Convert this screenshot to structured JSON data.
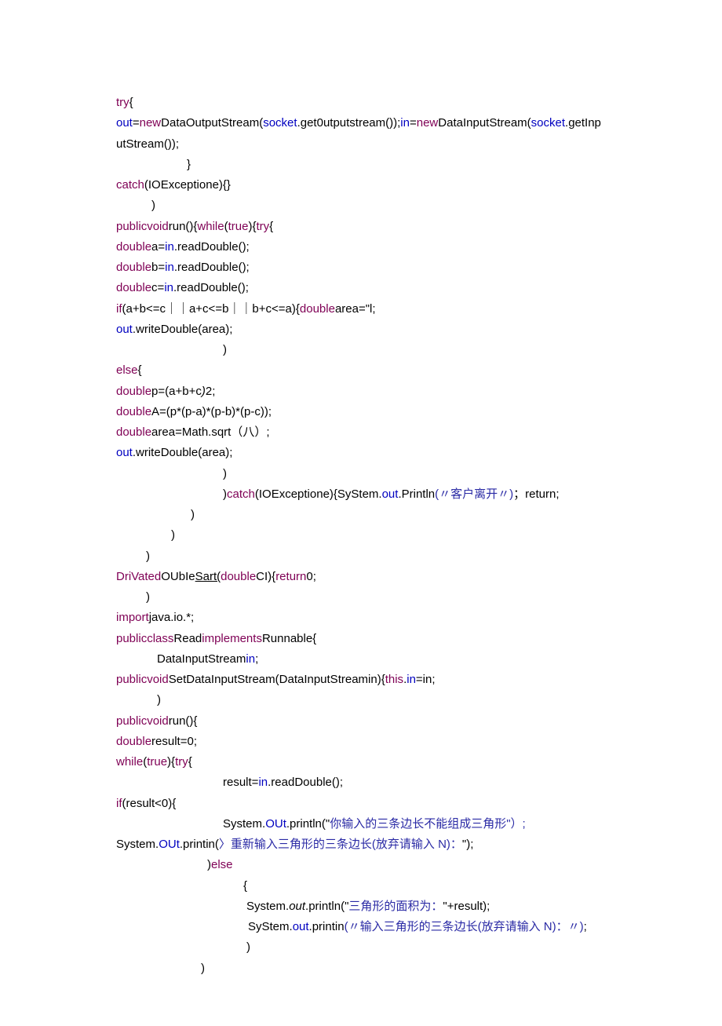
{
  "lines": [
    {
      "indent": 0,
      "spans": [
        {
          "t": "try",
          "c": "kw"
        },
        {
          "t": "{",
          "c": "blk"
        }
      ]
    },
    {
      "indent": 0,
      "spans": [
        {
          "t": "out",
          "c": "id"
        },
        {
          "t": "=",
          "c": "blk"
        },
        {
          "t": "new",
          "c": "kw"
        },
        {
          "t": "DataOutputStream(",
          "c": "blk"
        },
        {
          "t": "socket",
          "c": "id"
        },
        {
          "t": ".get0utputstream());",
          "c": "blk"
        },
        {
          "t": "in",
          "c": "id"
        },
        {
          "t": "=",
          "c": "blk"
        },
        {
          "t": "new",
          "c": "kw"
        },
        {
          "t": "DataInputStream(",
          "c": "blk"
        },
        {
          "t": "socket",
          "c": "id"
        },
        {
          "t": ".getInputStream());",
          "c": "blk"
        }
      ]
    },
    {
      "indent": 90,
      "spans": [
        {
          "t": "}",
          "c": "blk"
        }
      ]
    },
    {
      "indent": 0,
      "spans": [
        {
          "t": "catch",
          "c": "kw"
        },
        {
          "t": "(IOExceptione){}",
          "c": "blk"
        }
      ]
    },
    {
      "indent": 45,
      "spans": [
        {
          "t": ")",
          "c": "blk"
        }
      ]
    },
    {
      "indent": 0,
      "spans": [
        {
          "t": "public",
          "c": "kw"
        },
        {
          "t": "void",
          "c": "kw"
        },
        {
          "t": "run(){",
          "c": "blk"
        },
        {
          "t": "while",
          "c": "kw"
        },
        {
          "t": "(",
          "c": "blk"
        },
        {
          "t": "true",
          "c": "kw"
        },
        {
          "t": "){",
          "c": "blk"
        },
        {
          "t": "try",
          "c": "kw"
        },
        {
          "t": "{",
          "c": "blk"
        }
      ]
    },
    {
      "indent": 0,
      "spans": [
        {
          "t": "double",
          "c": "kw"
        },
        {
          "t": "a=",
          "c": "blk"
        },
        {
          "t": "in",
          "c": "id"
        },
        {
          "t": ".readDouble();",
          "c": "blk"
        }
      ]
    },
    {
      "indent": 0,
      "spans": [
        {
          "t": "double",
          "c": "kw"
        },
        {
          "t": "b=",
          "c": "blk"
        },
        {
          "t": "in",
          "c": "id"
        },
        {
          "t": ".readDouble();",
          "c": "blk"
        }
      ]
    },
    {
      "indent": 0,
      "spans": [
        {
          "t": "double",
          "c": "kw"
        },
        {
          "t": "c=",
          "c": "blk"
        },
        {
          "t": "in",
          "c": "id"
        },
        {
          "t": ".readDouble();",
          "c": "blk"
        }
      ]
    },
    {
      "indent": 0,
      "spans": [
        {
          "t": "if",
          "c": "kw"
        },
        {
          "t": "(a+b<=c｜｜a+c<=b｜｜b+c<=a){",
          "c": "blk"
        },
        {
          "t": "double",
          "c": "kw"
        },
        {
          "t": "area=\"l;",
          "c": "blk"
        }
      ]
    },
    {
      "indent": 0,
      "spans": [
        {
          "t": "out",
          "c": "id"
        },
        {
          "t": ".writeDouble(area);",
          "c": "blk"
        }
      ]
    },
    {
      "indent": 136,
      "spans": [
        {
          "t": ")",
          "c": "blk"
        }
      ]
    },
    {
      "indent": 0,
      "spans": [
        {
          "t": "else",
          "c": "kw"
        },
        {
          "t": "{",
          "c": "blk"
        }
      ]
    },
    {
      "indent": 0,
      "spans": [
        {
          "t": "double",
          "c": "kw"
        },
        {
          "t": "p=(a+b+c",
          "c": "blk"
        },
        {
          "t": ")",
          "c": "it"
        },
        {
          "t": "2;",
          "c": "blk"
        }
      ]
    },
    {
      "indent": 0,
      "spans": [
        {
          "t": "double",
          "c": "kw"
        },
        {
          "t": "A=(p*(p-a)*(p-b)*(p-c));",
          "c": "blk"
        }
      ]
    },
    {
      "indent": 0,
      "spans": [
        {
          "t": "double",
          "c": "kw"
        },
        {
          "t": "area=Math.sqrt（八）;",
          "c": "blk"
        }
      ]
    },
    {
      "indent": 0,
      "spans": [
        {
          "t": "out",
          "c": "id"
        },
        {
          "t": ".writeDouble(area);",
          "c": "blk"
        }
      ]
    },
    {
      "indent": 136,
      "spans": [
        {
          "t": ")",
          "c": "blk"
        }
      ]
    },
    {
      "indent": 136,
      "spans": [
        {
          "t": ")",
          "c": "blk"
        },
        {
          "t": "catch",
          "c": "kw"
        },
        {
          "t": "(IOExceptione){SyStem.",
          "c": "blk"
        },
        {
          "t": "out",
          "c": "id"
        },
        {
          "t": ".Println",
          "c": "blk"
        },
        {
          "t": "(〃客户离开〃)",
          "c": "str"
        },
        {
          "t": "；return;",
          "c": "blk"
        }
      ]
    },
    {
      "indent": 95,
      "spans": [
        {
          "t": ")",
          "c": "blk"
        }
      ]
    },
    {
      "indent": 70,
      "spans": [
        {
          "t": ")",
          "c": "blk"
        }
      ]
    },
    {
      "indent": 38,
      "spans": [
        {
          "t": ")",
          "c": "blk"
        }
      ]
    },
    {
      "indent": 0,
      "spans": [
        {
          "t": "DriVated",
          "c": "kw"
        },
        {
          "t": "OUbIe",
          "c": "blk"
        },
        {
          "t": "Sart(",
          "c": "ul"
        },
        {
          "t": "double",
          "c": "kw"
        },
        {
          "t": "CI){",
          "c": "blk"
        },
        {
          "t": "return",
          "c": "kw"
        },
        {
          "t": "0;",
          "c": "blk"
        }
      ]
    },
    {
      "indent": 38,
      "spans": [
        {
          "t": ")",
          "c": "blk"
        }
      ]
    },
    {
      "indent": 0,
      "spans": [
        {
          "t": "import",
          "c": "kw"
        },
        {
          "t": "java.io.*;",
          "c": "blk"
        }
      ]
    },
    {
      "indent": 0,
      "spans": [
        {
          "t": "public",
          "c": "kw"
        },
        {
          "t": "class",
          "c": "kw"
        },
        {
          "t": "Read",
          "c": "blk"
        },
        {
          "t": "implements",
          "c": "kw"
        },
        {
          "t": "Runnable{",
          "c": "blk"
        }
      ]
    },
    {
      "indent": 52,
      "spans": [
        {
          "t": "DataInputStream",
          "c": "blk"
        },
        {
          "t": "in",
          "c": "id"
        },
        {
          "t": ";",
          "c": "blk"
        }
      ]
    },
    {
      "indent": 0,
      "spans": [
        {
          "t": "public",
          "c": "kw"
        },
        {
          "t": "void",
          "c": "kw"
        },
        {
          "t": "SetDataInputStream(DataInputStreamin){",
          "c": "blk"
        },
        {
          "t": "this",
          "c": "kw"
        },
        {
          "t": ".",
          "c": "blk"
        },
        {
          "t": "in",
          "c": "id"
        },
        {
          "t": "=in;",
          "c": "blk"
        }
      ]
    },
    {
      "indent": 52,
      "spans": [
        {
          "t": ")",
          "c": "blk"
        }
      ]
    },
    {
      "indent": 0,
      "spans": [
        {
          "t": "public",
          "c": "kw"
        },
        {
          "t": "void",
          "c": "kw"
        },
        {
          "t": "run(){",
          "c": "blk"
        }
      ]
    },
    {
      "indent": 0,
      "spans": [
        {
          "t": "double",
          "c": "kw"
        },
        {
          "t": "result=0;",
          "c": "blk"
        }
      ]
    },
    {
      "indent": 0,
      "spans": [
        {
          "t": "while",
          "c": "kw"
        },
        {
          "t": "(",
          "c": "blk"
        },
        {
          "t": "true",
          "c": "kw"
        },
        {
          "t": "){",
          "c": "blk"
        },
        {
          "t": "try",
          "c": "kw"
        },
        {
          "t": "{",
          "c": "blk"
        }
      ]
    },
    {
      "indent": 136,
      "spans": [
        {
          "t": "result=",
          "c": "blk"
        },
        {
          "t": "in",
          "c": "id"
        },
        {
          "t": ".readDouble();",
          "c": "blk"
        }
      ]
    },
    {
      "indent": 0,
      "spans": [
        {
          "t": "if",
          "c": "kw"
        },
        {
          "t": "(result<0){",
          "c": "blk"
        }
      ]
    },
    {
      "indent": 136,
      "spans": [
        {
          "t": "System.",
          "c": "blk"
        },
        {
          "t": "OUt",
          "c": "id"
        },
        {
          "t": ".println(\"",
          "c": "blk"
        },
        {
          "t": "你输入的三条边长不能组成三角形\"）;",
          "c": "str"
        }
      ]
    },
    {
      "indent": 0,
      "spans": [
        {
          "t": "System.",
          "c": "blk"
        },
        {
          "t": "OUt",
          "c": "id"
        },
        {
          "t": ".printin(",
          "c": "blk"
        },
        {
          "t": "〉",
          "c": "str"
        },
        {
          "t": "重新输入三角形的三条边长(放弃请输入 N)：",
          "c": "str"
        },
        {
          "t": "\");",
          "c": "blk"
        }
      ]
    },
    {
      "indent": 116,
      "spans": [
        {
          "t": ")",
          "c": "blk"
        },
        {
          "t": "else",
          "c": "kw"
        }
      ]
    },
    {
      "indent": 162,
      "spans": [
        {
          "t": "{",
          "c": "blk"
        }
      ]
    },
    {
      "indent": 166,
      "spans": [
        {
          "t": "System.",
          "c": "blk"
        },
        {
          "t": "out",
          "c": "it"
        },
        {
          "t": ".println(\"",
          "c": "blk"
        },
        {
          "t": "三角形的面积为：",
          "c": "str"
        },
        {
          "t": "\"+result);",
          "c": "blk"
        }
      ]
    },
    {
      "indent": 168,
      "spans": [
        {
          "t": "SyStem.",
          "c": "blk"
        },
        {
          "t": "out",
          "c": "id"
        },
        {
          "t": ".printin",
          "c": "blk"
        },
        {
          "t": "(〃输入三角形的三条边长(放弃请输入 N)：〃)",
          "c": "str"
        },
        {
          "t": ";",
          "c": "blk"
        }
      ]
    },
    {
      "indent": 166,
      "spans": [
        {
          "t": ")",
          "c": "blk"
        }
      ]
    },
    {
      "indent": 108,
      "spans": [
        {
          "t": ")",
          "c": "blk"
        }
      ]
    }
  ]
}
